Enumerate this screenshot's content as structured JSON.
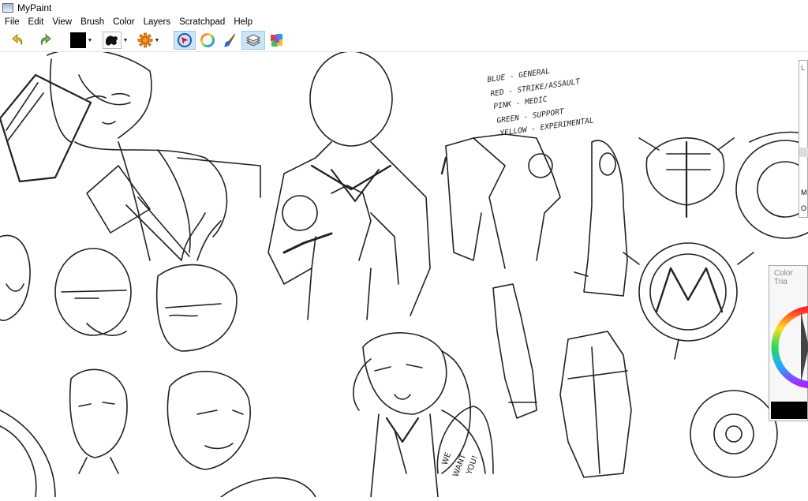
{
  "window": {
    "title": "MyPaint"
  },
  "menu": [
    "File",
    "Edit",
    "View",
    "Brush",
    "Color",
    "Layers",
    "Scratchpad",
    "Help"
  ],
  "toolbar": {
    "undo_icon": "undo-arrow-icon",
    "redo_icon": "redo-arrow-icon",
    "current_color": "#000000",
    "brush_icon": "brush-blob-icon",
    "brush_modifier_icon": "orange-gear-icon",
    "tools": [
      "freehand-icon",
      "color-wheel-icon",
      "paintbrush-icon",
      "layers-icon",
      "color-palette-icon"
    ]
  },
  "canvas": {
    "notes": [
      "BLUE - GENERAL",
      "RED - STRIKE/ASSAULT",
      "PINK - MEDIC",
      "GREEN - SUPPORT",
      "YELLOW - EXPERIMENTAL"
    ],
    "speech": [
      "WE",
      "WANT",
      "YOU!"
    ]
  },
  "panels": {
    "top_letter": "L",
    "side_letters": [
      "M",
      "O"
    ],
    "color_triangle_title": "Color Tria"
  }
}
